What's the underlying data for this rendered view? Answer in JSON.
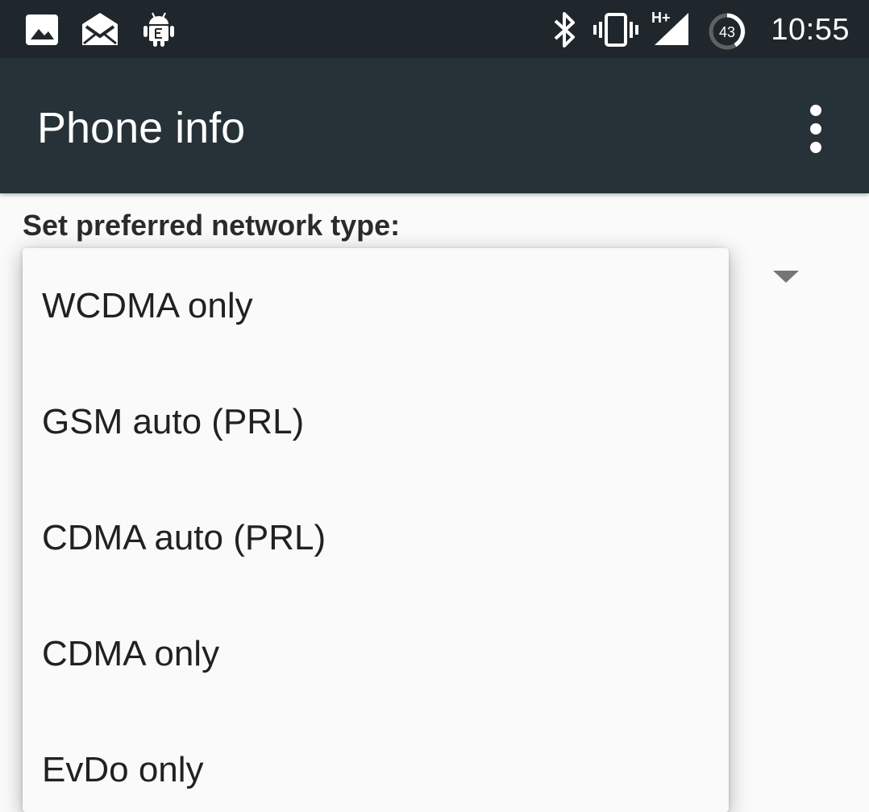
{
  "status_bar": {
    "time": "10:55",
    "battery_level": "43",
    "network_type": "H+",
    "icons": [
      "image-icon",
      "email-icon",
      "android-debug-icon",
      "bluetooth-icon",
      "vibrate-icon",
      "signal-icon",
      "battery-icon"
    ]
  },
  "app_bar": {
    "title": "Phone info",
    "menu_icon": "more-vert-icon"
  },
  "content": {
    "label": "Set preferred network type:"
  },
  "dropdown": {
    "options": [
      "WCDMA only",
      "GSM auto (PRL)",
      "CDMA auto (PRL)",
      "CDMA only",
      "EvDo only"
    ]
  },
  "colors": {
    "status_bar": "#1f272c",
    "app_bar": "#263238",
    "background": "#fafafa",
    "text_primary": "#212121"
  }
}
